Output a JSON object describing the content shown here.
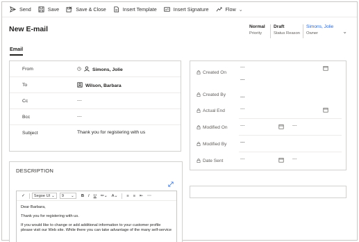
{
  "toolbar": {
    "send": "Send",
    "save": "Save",
    "save_close": "Save & Close",
    "insert_template": "Insert Template",
    "insert_signature": "Insert Signature",
    "flow": "Flow"
  },
  "header": {
    "title": "New E-mail",
    "priority_value": "Normal",
    "priority_label": "Priority",
    "status_value": "Draft",
    "status_label": "Status Reason",
    "owner_value": "Simons, Jolie",
    "owner_label": "Owner"
  },
  "tabs": {
    "email": "Email"
  },
  "email_form": {
    "from_label": "From",
    "from_value": "Simons, Jolie",
    "to_label": "To",
    "to_value": "Wilson, Barbara",
    "cc_label": "Cc",
    "cc_value": "---",
    "bcc_label": "Bcc",
    "bcc_value": "---",
    "subject_label": "Subject",
    "subject_value": "Thank you for registering with us"
  },
  "details": {
    "created_on_label": "Created On",
    "created_on_value": "---",
    "created_on_value2": "---",
    "created_by_label": "Created By",
    "created_by_value": "---",
    "actual_end_label": "Actual End",
    "actual_end_value": "---",
    "modified_on_label": "Modified On",
    "modified_on_value": "---",
    "modified_on_time": "---",
    "modified_by_label": "Modified By",
    "modified_by_value": "---",
    "date_sent_label": "Date Sent",
    "date_sent_value": "---",
    "date_sent_time": "---"
  },
  "description": {
    "title": "DESCRIPTION",
    "font_name": "Segoe UI",
    "font_size": "9",
    "body_greeting": "Dear Barbara,",
    "body_thanks": "Thank you for registering with us.",
    "body_line1": "If you would like to change or add additional information to your customer profile",
    "body_line2": "please visit our Web site. While there you can take advantage of the many self-service"
  },
  "icons": {
    "send": "send-icon",
    "save": "save-icon",
    "save_close": "save-close-icon",
    "template": "template-icon",
    "signature": "signature-icon",
    "flow": "flow-icon",
    "lock": "lock-icon",
    "calendar": "calendar-icon",
    "expand": "expand-icon"
  },
  "colors": {
    "accent": "#2266e3",
    "border": "#d2d0ce",
    "text": "#323130"
  }
}
